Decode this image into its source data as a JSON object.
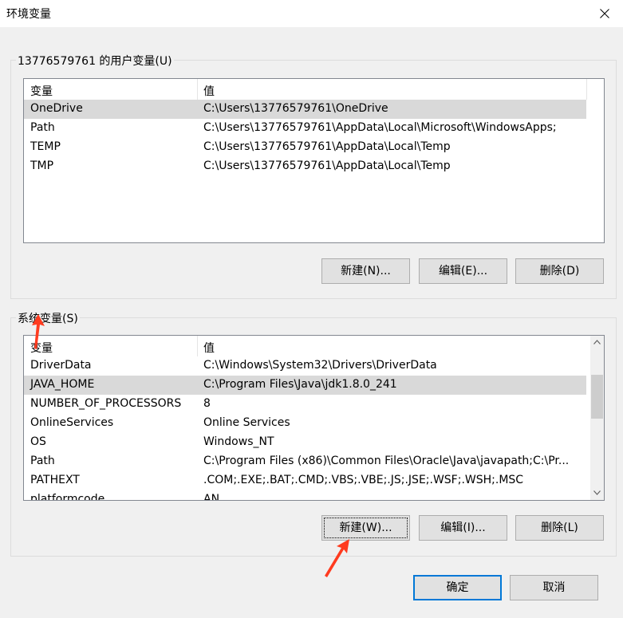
{
  "window": {
    "title": "环境变量"
  },
  "user_vars": {
    "group_label": "13776579761 的用户变量(U)",
    "columns": [
      "变量",
      "值"
    ],
    "rows": [
      {
        "name": "OneDrive",
        "value": "C:\\Users\\13776579761\\OneDrive",
        "selected": true
      },
      {
        "name": "Path",
        "value": "C:\\Users\\13776579761\\AppData\\Local\\Microsoft\\WindowsApps;",
        "selected": false
      },
      {
        "name": "TEMP",
        "value": "C:\\Users\\13776579761\\AppData\\Local\\Temp",
        "selected": false
      },
      {
        "name": "TMP",
        "value": "C:\\Users\\13776579761\\AppData\\Local\\Temp",
        "selected": false
      }
    ],
    "buttons": {
      "new": "新建(N)...",
      "edit": "编辑(E)...",
      "delete": "删除(D)"
    }
  },
  "system_vars": {
    "group_label": "系统变量(S)",
    "columns": [
      "变量",
      "值"
    ],
    "rows": [
      {
        "name": "DriverData",
        "value": "C:\\Windows\\System32\\Drivers\\DriverData",
        "selected": false
      },
      {
        "name": "JAVA_HOME",
        "value": "C:\\Program Files\\Java\\jdk1.8.0_241",
        "selected": true
      },
      {
        "name": "NUMBER_OF_PROCESSORS",
        "value": "8",
        "selected": false
      },
      {
        "name": "OnlineServices",
        "value": "Online Services",
        "selected": false
      },
      {
        "name": "OS",
        "value": "Windows_NT",
        "selected": false
      },
      {
        "name": "Path",
        "value": "C:\\Program Files (x86)\\Common Files\\Oracle\\Java\\javapath;C:\\Pr...",
        "selected": false
      },
      {
        "name": "PATHEXT",
        "value": ".COM;.EXE;.BAT;.CMD;.VBS;.VBE;.JS;.JSE;.WSF;.WSH;.MSC",
        "selected": false
      },
      {
        "name": "platformcode",
        "value": "AN",
        "selected": false
      }
    ],
    "scroll_position": 0.27,
    "buttons": {
      "new": "新建(W)...",
      "edit": "编辑(I)...",
      "delete": "删除(L)"
    }
  },
  "dialog_buttons": {
    "ok": "确定",
    "cancel": "取消"
  },
  "colors": {
    "annotation_arrow": "#ff3b1f",
    "default_button_border": "#0078d7",
    "selection": "#d9d9d9"
  }
}
